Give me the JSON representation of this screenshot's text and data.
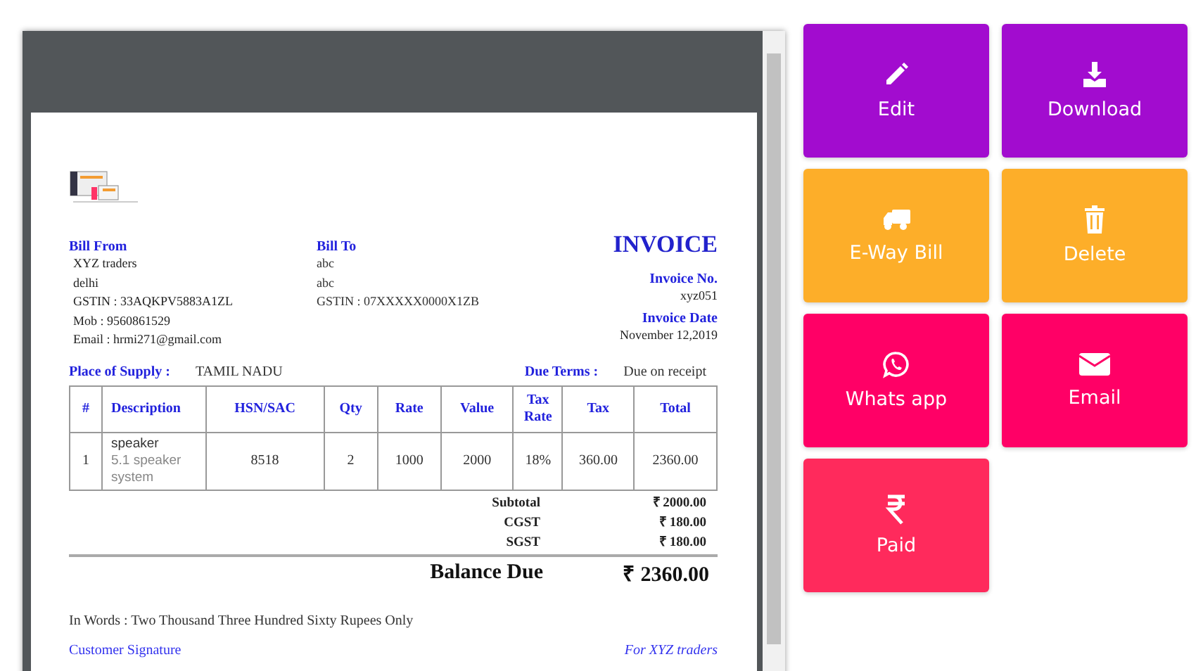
{
  "invoice": {
    "bill_from": {
      "heading": "Bill From",
      "lines": [
        "XYZ traders",
        "delhi",
        "GSTIN : 33AQKPV5883A1ZL",
        "Mob : 9560861529",
        "Email : hrmi271@gmail.com"
      ]
    },
    "bill_to": {
      "heading": "Bill To",
      "lines": [
        "abc",
        "abc",
        "GSTIN : 07XXXXX0000X1ZB"
      ]
    },
    "title": "INVOICE",
    "invoice_no_label": "Invoice No.",
    "invoice_no": "xyz051",
    "invoice_date_label": "Invoice Date",
    "invoice_date": "November 12,2019",
    "place_of_supply_label": "Place of Supply :",
    "place_of_supply": "TAMIL NADU",
    "due_terms_label": "Due Terms :",
    "due_terms": "Due on receipt",
    "table": {
      "columns": [
        "#",
        "Description",
        "HSN/SAC",
        "Qty",
        "Rate",
        "Value",
        "Tax Rate",
        "Tax",
        "Total"
      ],
      "rows": [
        {
          "num": "1",
          "item": "speaker",
          "detail": "5.1 speaker system",
          "hsn": "8518",
          "qty": "2",
          "rate": "1000",
          "value": "2000",
          "tax_rate": "18%",
          "tax": "360.00",
          "total": "2360.00"
        }
      ]
    },
    "totals": [
      {
        "label": "Subtotal",
        "amount": "₹ 2000.00"
      },
      {
        "label": "CGST",
        "amount": "₹ 180.00"
      },
      {
        "label": "SGST",
        "amount": "₹ 180.00"
      }
    ],
    "balance_label": "Balance Due",
    "balance": "₹ 2360.00",
    "in_words": "In Words :  Two Thousand Three Hundred Sixty Rupees  Only",
    "customer_signature": "Customer Signature",
    "for_company": "For XYZ traders"
  },
  "actions": [
    {
      "label": "Edit",
      "kind": "edit",
      "color": "#a20ccf"
    },
    {
      "label": "Download",
      "kind": "download",
      "color": "#a20ccf"
    },
    {
      "label": "E-Way Bill",
      "kind": "truck",
      "color": "#fdae29"
    },
    {
      "label": "Delete",
      "kind": "delete",
      "color": "#fdae29"
    },
    {
      "label": "Whats app",
      "kind": "whatsapp",
      "color": "#ff0066"
    },
    {
      "label": "Email",
      "kind": "email",
      "color": "#ff0066"
    },
    {
      "label": "Paid",
      "kind": "rupee",
      "color": "#ff2a5c"
    }
  ]
}
